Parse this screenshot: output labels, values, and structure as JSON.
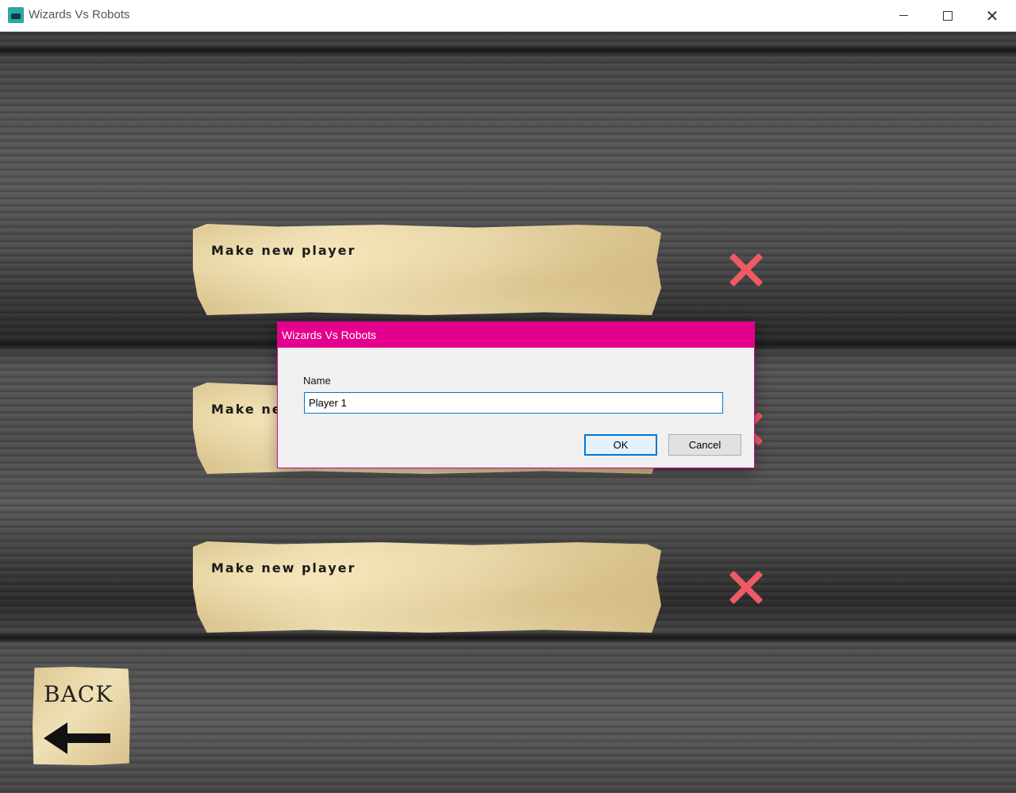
{
  "window": {
    "title": "Wizards Vs Robots",
    "icon": "wizards-vs-robots-app-icon",
    "controls": [
      "minimize-icon",
      "maximize-icon",
      "close-icon"
    ]
  },
  "slots": [
    {
      "label": "Make new player",
      "delete_icon": "red-x-icon"
    },
    {
      "label": "Make new player",
      "delete_icon": "red-x-icon"
    },
    {
      "label": "Make new player",
      "delete_icon": "red-x-icon"
    }
  ],
  "back_button": {
    "label": "BACK",
    "icon": "left-arrow-icon"
  },
  "dialog": {
    "title": "Wizards Vs Robots",
    "field_label": "Name",
    "field_value": "Player 1",
    "ok_label": "OK",
    "cancel_label": "Cancel"
  },
  "colors": {
    "dialog_accent": "#e4008c",
    "delete_x": "#f05a64",
    "parchment": "#e7d5a6",
    "wood": "#4e4e4e"
  }
}
